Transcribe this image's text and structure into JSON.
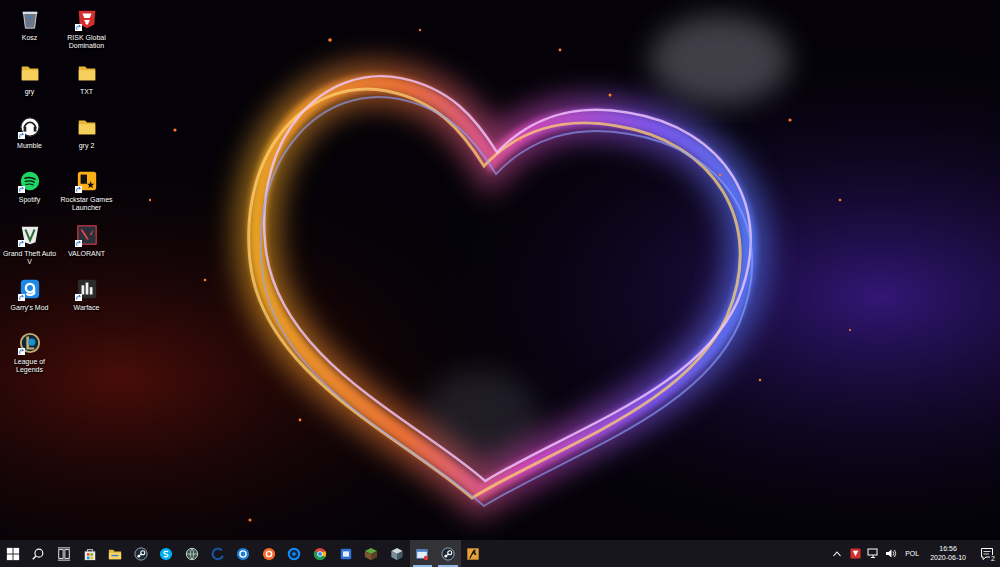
{
  "desktop": {
    "icons": [
      {
        "label": "Kosz",
        "kind": "recycle-bin",
        "shortcut": false
      },
      {
        "label": "RISK Global Domination",
        "kind": "risk",
        "shortcut": true
      },
      {
        "label": "gry",
        "kind": "folder",
        "shortcut": false
      },
      {
        "label": "TXT",
        "kind": "folder",
        "shortcut": false
      },
      {
        "label": "Mumble",
        "kind": "mumble",
        "shortcut": true
      },
      {
        "label": "gry 2",
        "kind": "folder",
        "shortcut": false
      },
      {
        "label": "Spotify",
        "kind": "spotify",
        "shortcut": true
      },
      {
        "label": "Rockstar Games Launcher",
        "kind": "rockstar",
        "shortcut": true
      },
      {
        "label": "Grand Theft Auto V",
        "kind": "gta",
        "shortcut": true
      },
      {
        "label": "VALORANT",
        "kind": "valorant",
        "shortcut": true
      },
      {
        "label": "Garry's Mod",
        "kind": "gmod",
        "shortcut": true
      },
      {
        "label": "Warface",
        "kind": "warface",
        "shortcut": true
      },
      {
        "label": "League of Legends",
        "kind": "lol",
        "shortcut": true
      }
    ]
  },
  "taskbar": {
    "system_buttons": [
      {
        "kind": "start"
      },
      {
        "kind": "search"
      },
      {
        "kind": "task-view"
      }
    ],
    "pinned": [
      {
        "kind": "store",
        "running": false
      },
      {
        "kind": "explorer",
        "running": false
      },
      {
        "kind": "steam",
        "running": false
      },
      {
        "kind": "skype",
        "running": false
      },
      {
        "kind": "globe",
        "running": false
      },
      {
        "kind": "edge",
        "running": false
      },
      {
        "kind": "uplay",
        "running": false
      },
      {
        "kind": "origin",
        "running": false
      },
      {
        "kind": "battlenet",
        "running": false
      },
      {
        "kind": "chrome",
        "running": false
      },
      {
        "kind": "app",
        "running": false
      },
      {
        "kind": "minecraft",
        "running": false
      },
      {
        "kind": "cube",
        "running": false
      },
      {
        "kind": "window",
        "running": true
      },
      {
        "kind": "steam",
        "running": true
      },
      {
        "kind": "cs",
        "running": false
      }
    ],
    "tray": {
      "language": "POL",
      "time": "16:56",
      "date": "2020-06-10",
      "notifications": "2"
    }
  }
}
